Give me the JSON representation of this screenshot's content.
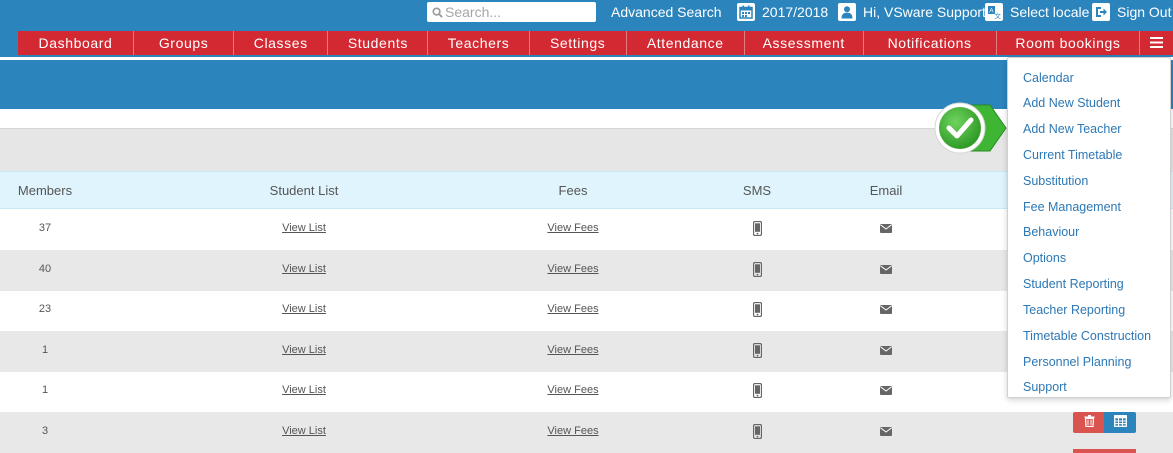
{
  "header": {
    "search_placeholder": "Search...",
    "advanced_search": "Advanced Search",
    "academic_year": "2017/2018",
    "greeting": "Hi, VSware Support",
    "select_locale": "Select locale",
    "sign_out": "Sign Out"
  },
  "nav": {
    "items": [
      "Dashboard",
      "Groups",
      "Classes",
      "Students",
      "Teachers",
      "Settings",
      "Attendance",
      "Assessment",
      "Notifications",
      "Room bookings"
    ],
    "more_icon": "hamburger-icon"
  },
  "table": {
    "headers": {
      "members": "Members",
      "student_list": "Student List",
      "fees": "Fees",
      "sms": "SMS",
      "email": "Email"
    },
    "rows": [
      {
        "members": "37",
        "student_list": "View List",
        "fees": "View Fees"
      },
      {
        "members": "40",
        "student_list": "View List",
        "fees": "View Fees"
      },
      {
        "members": "23",
        "student_list": "View List",
        "fees": "View Fees"
      },
      {
        "members": "1",
        "student_list": "View List",
        "fees": "View Fees"
      },
      {
        "members": "1",
        "student_list": "View List",
        "fees": "View Fees"
      },
      {
        "members": "3",
        "student_list": "View List",
        "fees": "View Fees"
      }
    ]
  },
  "dropdown": {
    "items": [
      "Calendar",
      "Add New Student",
      "Add New Teacher",
      "Current Timetable",
      "Substitution",
      "Fee Management",
      "Behaviour",
      "Options",
      "Student Reporting",
      "Teacher Reporting",
      "Timetable Construction",
      "Personnel Planning",
      "Support"
    ]
  },
  "colors": {
    "brand_blue": "#2b84bc",
    "nav_red": "#d22932",
    "link_blue": "#2d78b5",
    "table_header": "#dff4fd",
    "badge_green": "#3fb534"
  }
}
